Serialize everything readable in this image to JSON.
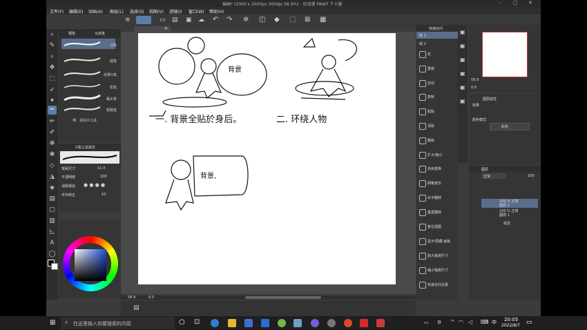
{
  "window": {
    "title": "插画* (2000 x 2000px 300dpi 58.9%) - 优动漫 PAINT 个人版"
  },
  "menu": [
    "文件(F)",
    "编辑(E)",
    "动画(A)",
    "图层(L)",
    "选择(S)",
    "视图(V)",
    "滤镜(I)",
    "窗口(W)",
    "帮助(H)"
  ],
  "brush_panel": {
    "tab_label": "钢笔",
    "tab2": "马克笔",
    "brushes": [
      "G笔",
      "圆笔",
      "效果G笔",
      "铅笔",
      "蘸水笔",
      "粗糙笔"
    ],
    "add_tool": "添加子工具"
  },
  "tool_property": {
    "title": "G笔工具属性",
    "brush_size_label": "笔刷尺寸",
    "brush_size_value": "11.4",
    "opacity_label": "不透明度",
    "opacity_value": "100",
    "correction_label": "消除锯齿",
    "stabilization_label": "手抖修正",
    "stabilization_value": "10"
  },
  "quick_access": {
    "title": "快速访问",
    "set_tabs": [
      "组 1",
      "组 2"
    ],
    "commands": [
      "定 ",
      "重做",
      "剪切",
      "复制",
      "粘贴",
      "清除",
      "删除",
      "扩大/缩小",
      "自由变换",
      "网格变形",
      "水平翻转",
      "垂直翻转",
      "复位视图",
      "显示/隐藏 画板",
      "放大笔刷尺寸",
      "缩小笔刷尺寸",
      "快速访问设置"
    ]
  },
  "navigator": {
    "zoom": "58.9",
    "rotate": "0.0"
  },
  "color_panel": {
    "title": "图层属性",
    "effect_label": "效果",
    "mode_label": "颜色模式",
    "mode_value": "彩色"
  },
  "layers": {
    "title": "图层",
    "blend": "正常",
    "opacity": "100",
    "rows": [
      {
        "name": "100 % 正常",
        "sub": "图层 2",
        "selected": true
      },
      {
        "name": "100 % 正常",
        "sub": "图层 1",
        "selected": false
      },
      {
        "name": "纸张",
        "sub": "",
        "selected": false
      }
    ]
  },
  "canvas": {
    "labels": [
      "一. 背景全贴於身后。",
      "二. 环绕人物",
      "背景",
      "背景,"
    ]
  },
  "statusbar": {
    "zoom": "58.9",
    "pos": "0.0"
  },
  "taskbar": {
    "search_placeholder": "在这里输入你要搜索的内容",
    "time": "20:05",
    "date": "2022/8/7",
    "ime": "中"
  }
}
